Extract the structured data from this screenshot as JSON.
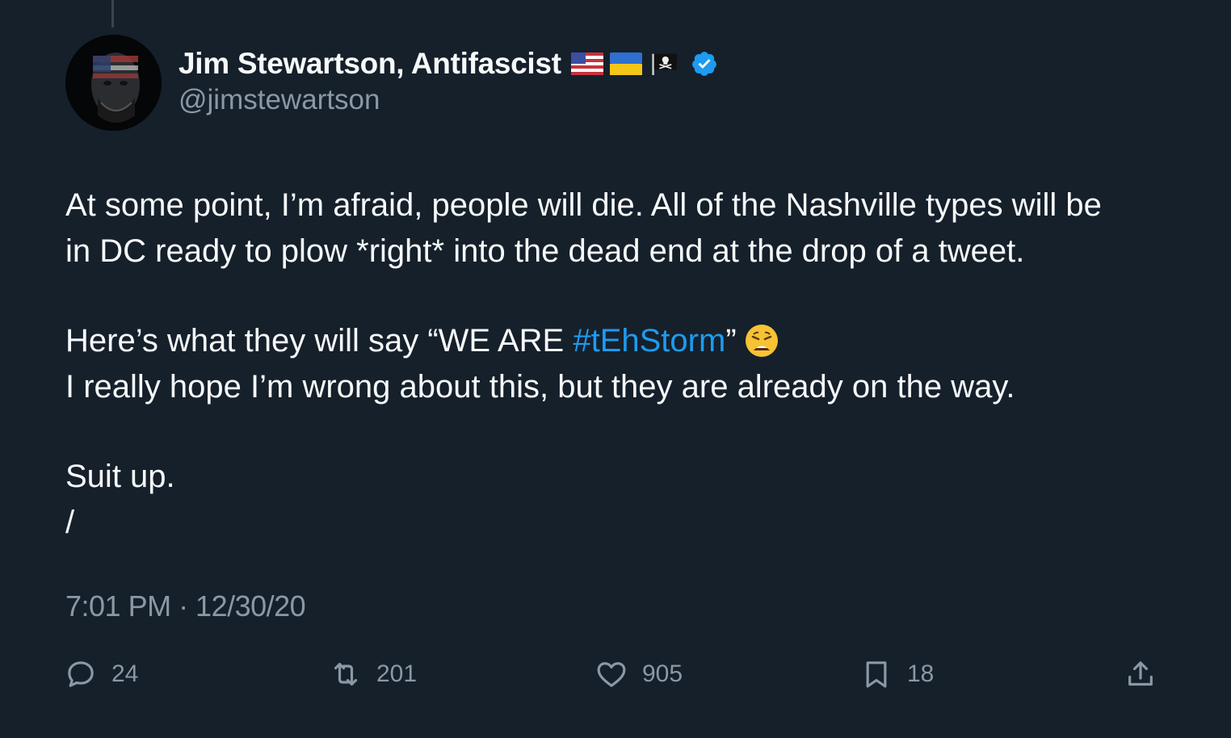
{
  "tweet": {
    "display_name": "Jim Stewartson, Antifascist",
    "handle": "@jimstewartson",
    "name_icons": [
      "us-flag-icon",
      "ukraine-flag-icon",
      "pirate-flag-icon",
      "verified-badge-icon"
    ],
    "body": {
      "line1": "At some point, I’m afraid, people will die. All of the Nashville types will be",
      "line2": "in DC ready to plow *right* into the dead end at the drop of a tweet.",
      "line3_before": "Here’s what they will say “WE ARE ",
      "hashtag": "#tEhStorm",
      "line3_after": "”",
      "line3_emoji": "weary-face-emoji-icon",
      "line4": "I really hope I’m wrong about this, but they are already on the way.",
      "line5": "Suit up.",
      "line6": "/"
    },
    "timestamp": "7:01 PM · 12/30/20",
    "actions": {
      "replies": "24",
      "retweets": "201",
      "likes": "905",
      "bookmarks": "18"
    }
  },
  "colors": {
    "background": "#15202b",
    "text": "#f7f9f9",
    "secondary_text": "#8b98a5",
    "link": "#1d9bf0",
    "verified": "#1d9bf0"
  }
}
